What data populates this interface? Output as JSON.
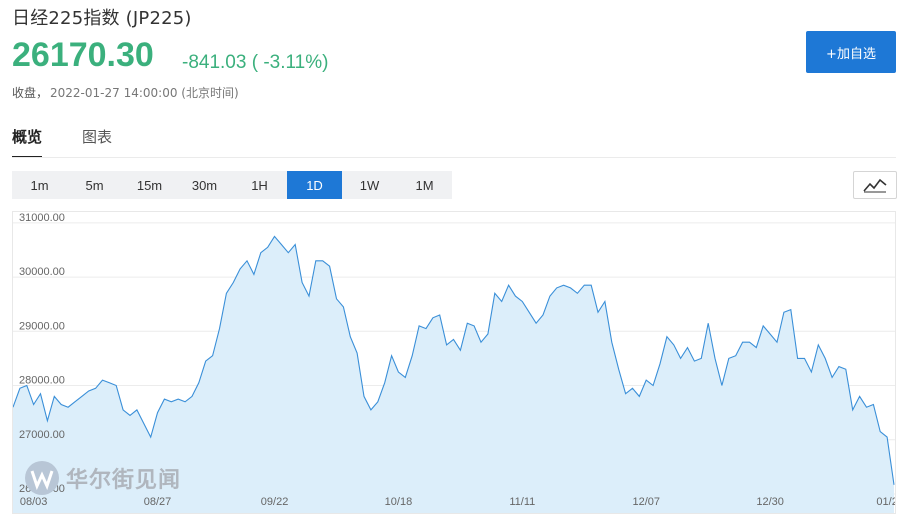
{
  "header": {
    "title": "日经225指数 (JP225)",
    "price": "26170.30",
    "change": "-841.03 ( -3.11%)",
    "status_label": "收盘，",
    "timestamp": "2022-01-27 14:00:00 (北京时间)",
    "add_button_label": "+加自选"
  },
  "tabs": [
    {
      "label": "概览",
      "active": true
    },
    {
      "label": "图表",
      "active": false
    }
  ],
  "periods": [
    {
      "label": "1m",
      "active": false
    },
    {
      "label": "5m",
      "active": false
    },
    {
      "label": "15m",
      "active": false
    },
    {
      "label": "30m",
      "active": false
    },
    {
      "label": "1H",
      "active": false
    },
    {
      "label": "1D",
      "active": true
    },
    {
      "label": "1W",
      "active": false
    },
    {
      "label": "1M",
      "active": false
    }
  ],
  "chart_toggle_icon": "line-chart-icon",
  "watermark": {
    "text": "华尔街见闻",
    "icon": "wallstreetcn-logo"
  },
  "colors": {
    "up_green": "#3bb07d",
    "accent_blue": "#1e78d6",
    "area_fill": "#dceefa",
    "line": "#3a8fd8"
  },
  "chart_data": {
    "type": "area",
    "ylim": [
      26000,
      31200
    ],
    "yticks": [
      {
        "value": 31000,
        "label": "31000.00"
      },
      {
        "value": 30000,
        "label": "30000.00"
      },
      {
        "value": 29000,
        "label": "29000.00"
      },
      {
        "value": 28000,
        "label": "28000.00"
      },
      {
        "value": 27000,
        "label": "27000.00"
      },
      {
        "value": 26000,
        "label": "26000.00"
      }
    ],
    "xticks": [
      {
        "index": 3,
        "label": "08/03"
      },
      {
        "index": 21,
        "label": "08/27"
      },
      {
        "index": 38,
        "label": "09/22"
      },
      {
        "index": 56,
        "label": "10/18"
      },
      {
        "index": 74,
        "label": "11/11"
      },
      {
        "index": 92,
        "label": "12/07"
      },
      {
        "index": 110,
        "label": "12/30"
      },
      {
        "index": 127,
        "label": "01/2"
      }
    ],
    "series": [
      {
        "values": [
          27600,
          27950,
          28000,
          27650,
          27850,
          27350,
          27800,
          27650,
          27600,
          27700,
          27800,
          27900,
          27950,
          28100,
          28050,
          28000,
          27550,
          27450,
          27550,
          27300,
          27050,
          27500,
          27750,
          27700,
          27750,
          27700,
          27800,
          28050,
          28450,
          28550,
          29050,
          29700,
          29900,
          30150,
          30300,
          30050,
          30450,
          30550,
          30750,
          30600,
          30450,
          30600,
          29900,
          29650,
          30300,
          30300,
          30200,
          29600,
          29450,
          28900,
          28600,
          27800,
          27550,
          27700,
          28050,
          28550,
          28250,
          28150,
          28550,
          29100,
          29050,
          29250,
          29300,
          28750,
          28850,
          28650,
          29150,
          29100,
          28800,
          28950,
          29700,
          29550,
          29850,
          29650,
          29550,
          29350,
          29150,
          29300,
          29650,
          29800,
          29850,
          29800,
          29700,
          29850,
          29850,
          29350,
          29550,
          28800,
          28300,
          27850,
          27950,
          27800,
          28100,
          28000,
          28400,
          28900,
          28750,
          28500,
          28700,
          28450,
          28500,
          29150,
          28500,
          28000,
          28500,
          28550,
          28800,
          28800,
          28700,
          29100,
          28950,
          28800,
          29350,
          29400,
          28500,
          28500,
          28250,
          28750,
          28500,
          28150,
          28350,
          28300,
          27550,
          27800,
          27600,
          27650,
          27150,
          27050,
          26170
        ]
      }
    ]
  }
}
